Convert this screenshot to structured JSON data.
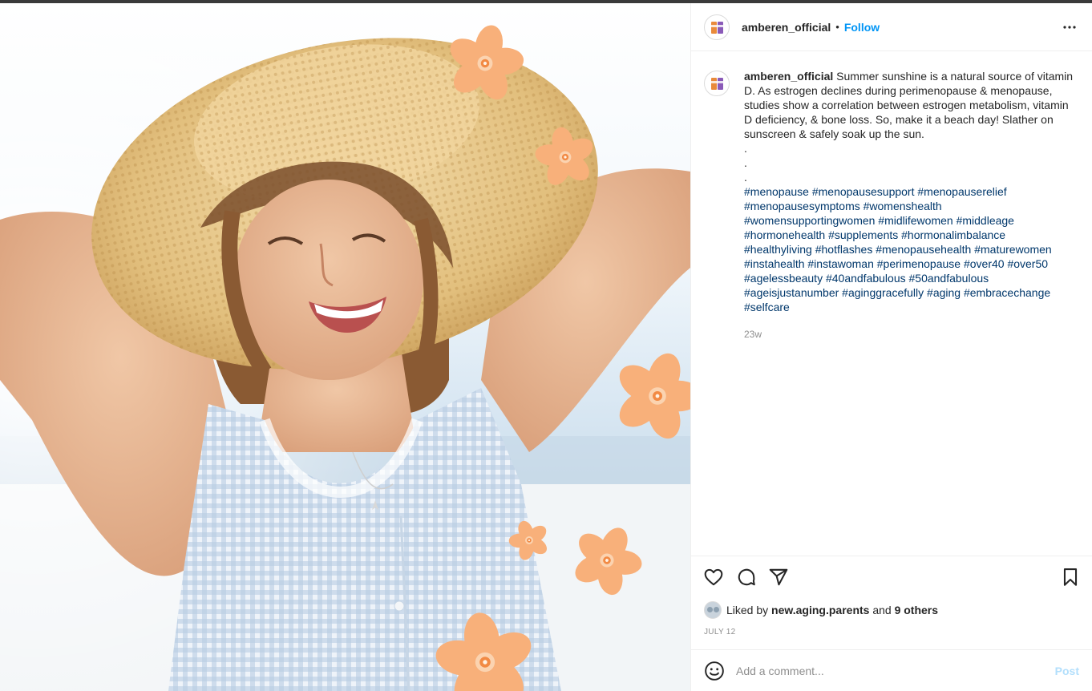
{
  "post": {
    "username": "amberen_official",
    "follow_label": "Follow",
    "separator": "•",
    "caption_text": "Summer sunshine is a natural source of vitamin D. As estrogen declines during perimenopause & menopause, studies show a correlation between estrogen metabolism, vitamin D deficiency, & bone loss. So, make it a beach day! Slather on sunscreen & safely soak up the sun.",
    "dots": [
      ".",
      ".",
      "."
    ],
    "hashtags": "#menopause #menopausesupport #menopauserelief #menopausesymptoms #womenshealth #womensupportingwomen #midlifewomen #middleage #hormonehealth #supplements #hormonalimbalance #healthyliving #hotflashes #menopausehealth #maturewomen #instahealth #instawoman #perimenopause #over40 #over50 #agelessbeauty #40andfabulous #50andfabulous #ageisjustanumber #aginggracefully #aging #embracechange #selfcare",
    "time_ago": "23w",
    "liked_by_prefix": "Liked by",
    "liked_by_user": "new.aging.parents",
    "liked_by_and": "and",
    "liked_by_others": "9 others",
    "date": "JULY 12",
    "comment_placeholder": "Add a comment...",
    "post_label": "Post"
  },
  "icons": {
    "more": "more-options-icon",
    "like": "heart-icon",
    "comment": "comment-icon",
    "share": "paper-plane-icon",
    "save": "bookmark-icon",
    "emoji": "emoji-icon"
  },
  "colors": {
    "link_blue": "#0095f6",
    "hashtag": "#00376b",
    "muted": "#8e8e8e",
    "post_disabled": "#b2dffc",
    "flower": "#f6a66b"
  }
}
